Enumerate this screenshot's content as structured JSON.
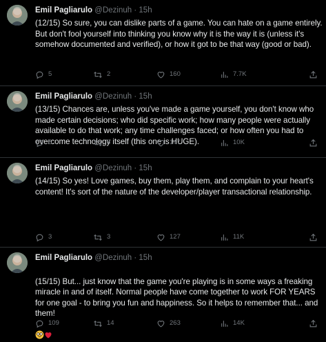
{
  "author": {
    "name": "Emil Pagliarulo",
    "handle": "@Dezinuh",
    "separator": "·"
  },
  "tweets": [
    {
      "time": "15h",
      "text": "(12/15) So sure, you can dislike parts of a game. You can hate on a game entirely. But don't fool yourself into thinking you know why it is the way it is (unless it's somehow documented and verified), or how it got to be that way (good or bad).",
      "replies": "5",
      "retweets": "2",
      "likes": "160",
      "views": "7.7K"
    },
    {
      "time": "15h",
      "text": "(13/15) Chances are, unless you've made a game yourself, you don't know who made certain decisions; who did specific work; how many people were actually available to do that work; any time challenges faced; or how often you had to overcome technology itself (this one is HUGE).",
      "replies": "8",
      "retweets": "8",
      "likes": "147",
      "views": "10K"
    },
    {
      "time": "15h",
      "text": "(14/15) So yes! Love games, buy them, play them, and complain to your heart's content! It's sort of the nature of the developer/player transactional relationship.",
      "replies": "3",
      "retweets": "3",
      "likes": "127",
      "views": "11K"
    },
    {
      "time": "15h",
      "text": "(15/15) But... just know that the game you're playing is in some ways a freaking miracle in and of itself. Normal people have come together to work FOR YEARS for one goal - to bring you fun and happiness. So it helps to remember that... and them!",
      "emojis": [
        "nerd-face-emoji",
        "red-heart-emoji"
      ],
      "replies": "109",
      "retweets": "14",
      "likes": "263",
      "views": "14K"
    }
  ],
  "colors": {
    "background": "#000000",
    "text": "#e7e9ea",
    "muted": "#71767b",
    "divider": "#2f3336",
    "heart": "#f91880"
  },
  "icons": [
    "reply-icon",
    "retweet-icon",
    "like-icon",
    "views-icon",
    "share-icon"
  ]
}
